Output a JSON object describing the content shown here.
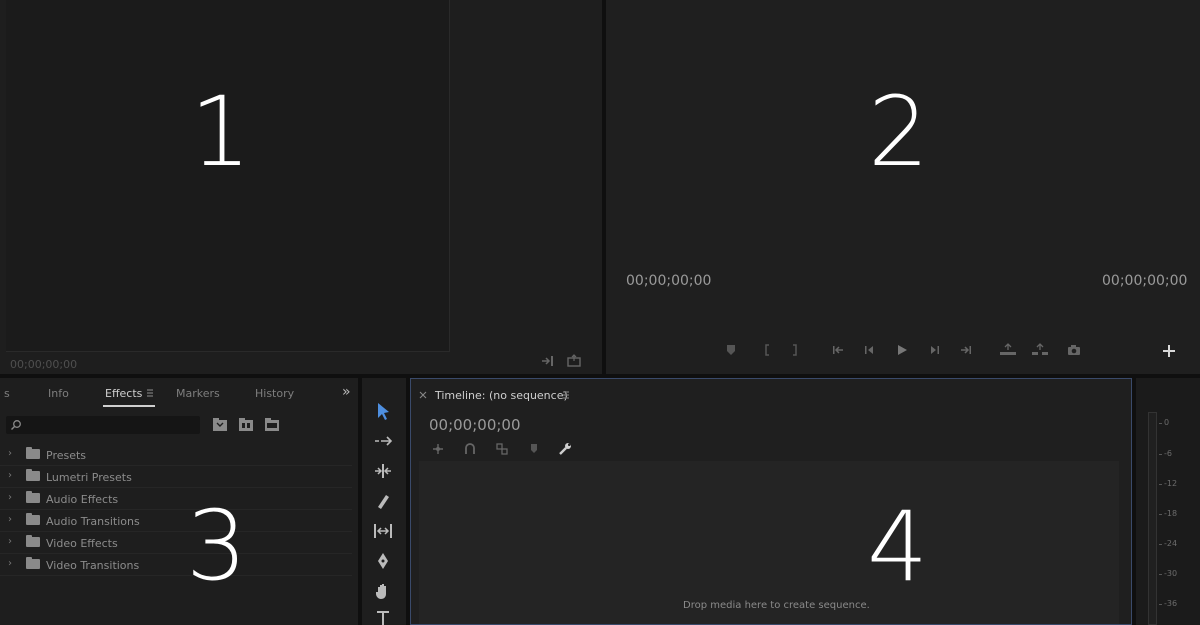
{
  "panels": {
    "source": {
      "number": "1",
      "timecode": "00;00;00;00"
    },
    "program": {
      "number": "2",
      "timecode_left": "00;00;00;00",
      "timecode_right": "00;00;00;00"
    },
    "effects": {
      "number": "3",
      "tabs": [
        {
          "label": "s",
          "active": false
        },
        {
          "label": "Info",
          "active": false
        },
        {
          "label": "Effects",
          "active": true
        },
        {
          "label": "Markers",
          "active": false
        },
        {
          "label": "History",
          "active": false
        }
      ],
      "more": "»",
      "tree": [
        {
          "label": "Presets",
          "icon": "presets-folder-icon"
        },
        {
          "label": "Lumetri Presets",
          "icon": "presets-folder-icon"
        },
        {
          "label": "Audio Effects",
          "icon": "folder-icon"
        },
        {
          "label": "Audio Transitions",
          "icon": "folder-icon"
        },
        {
          "label": "Video Effects",
          "icon": "folder-icon"
        },
        {
          "label": "Video Transitions",
          "icon": "folder-icon"
        }
      ]
    },
    "timeline": {
      "number": "4",
      "tab_title": "Timeline: (no sequence)",
      "timecode": "00;00;00;00",
      "drop_hint": "Drop media here to create sequence."
    },
    "meters": {
      "ticks": [
        "0",
        "-6",
        "-12",
        "-18",
        "-24",
        "-30",
        "-36"
      ]
    }
  },
  "colors": {
    "accent": "#3a4a6a",
    "panel": "#1e1e1e",
    "big_number": "#ffffff"
  }
}
